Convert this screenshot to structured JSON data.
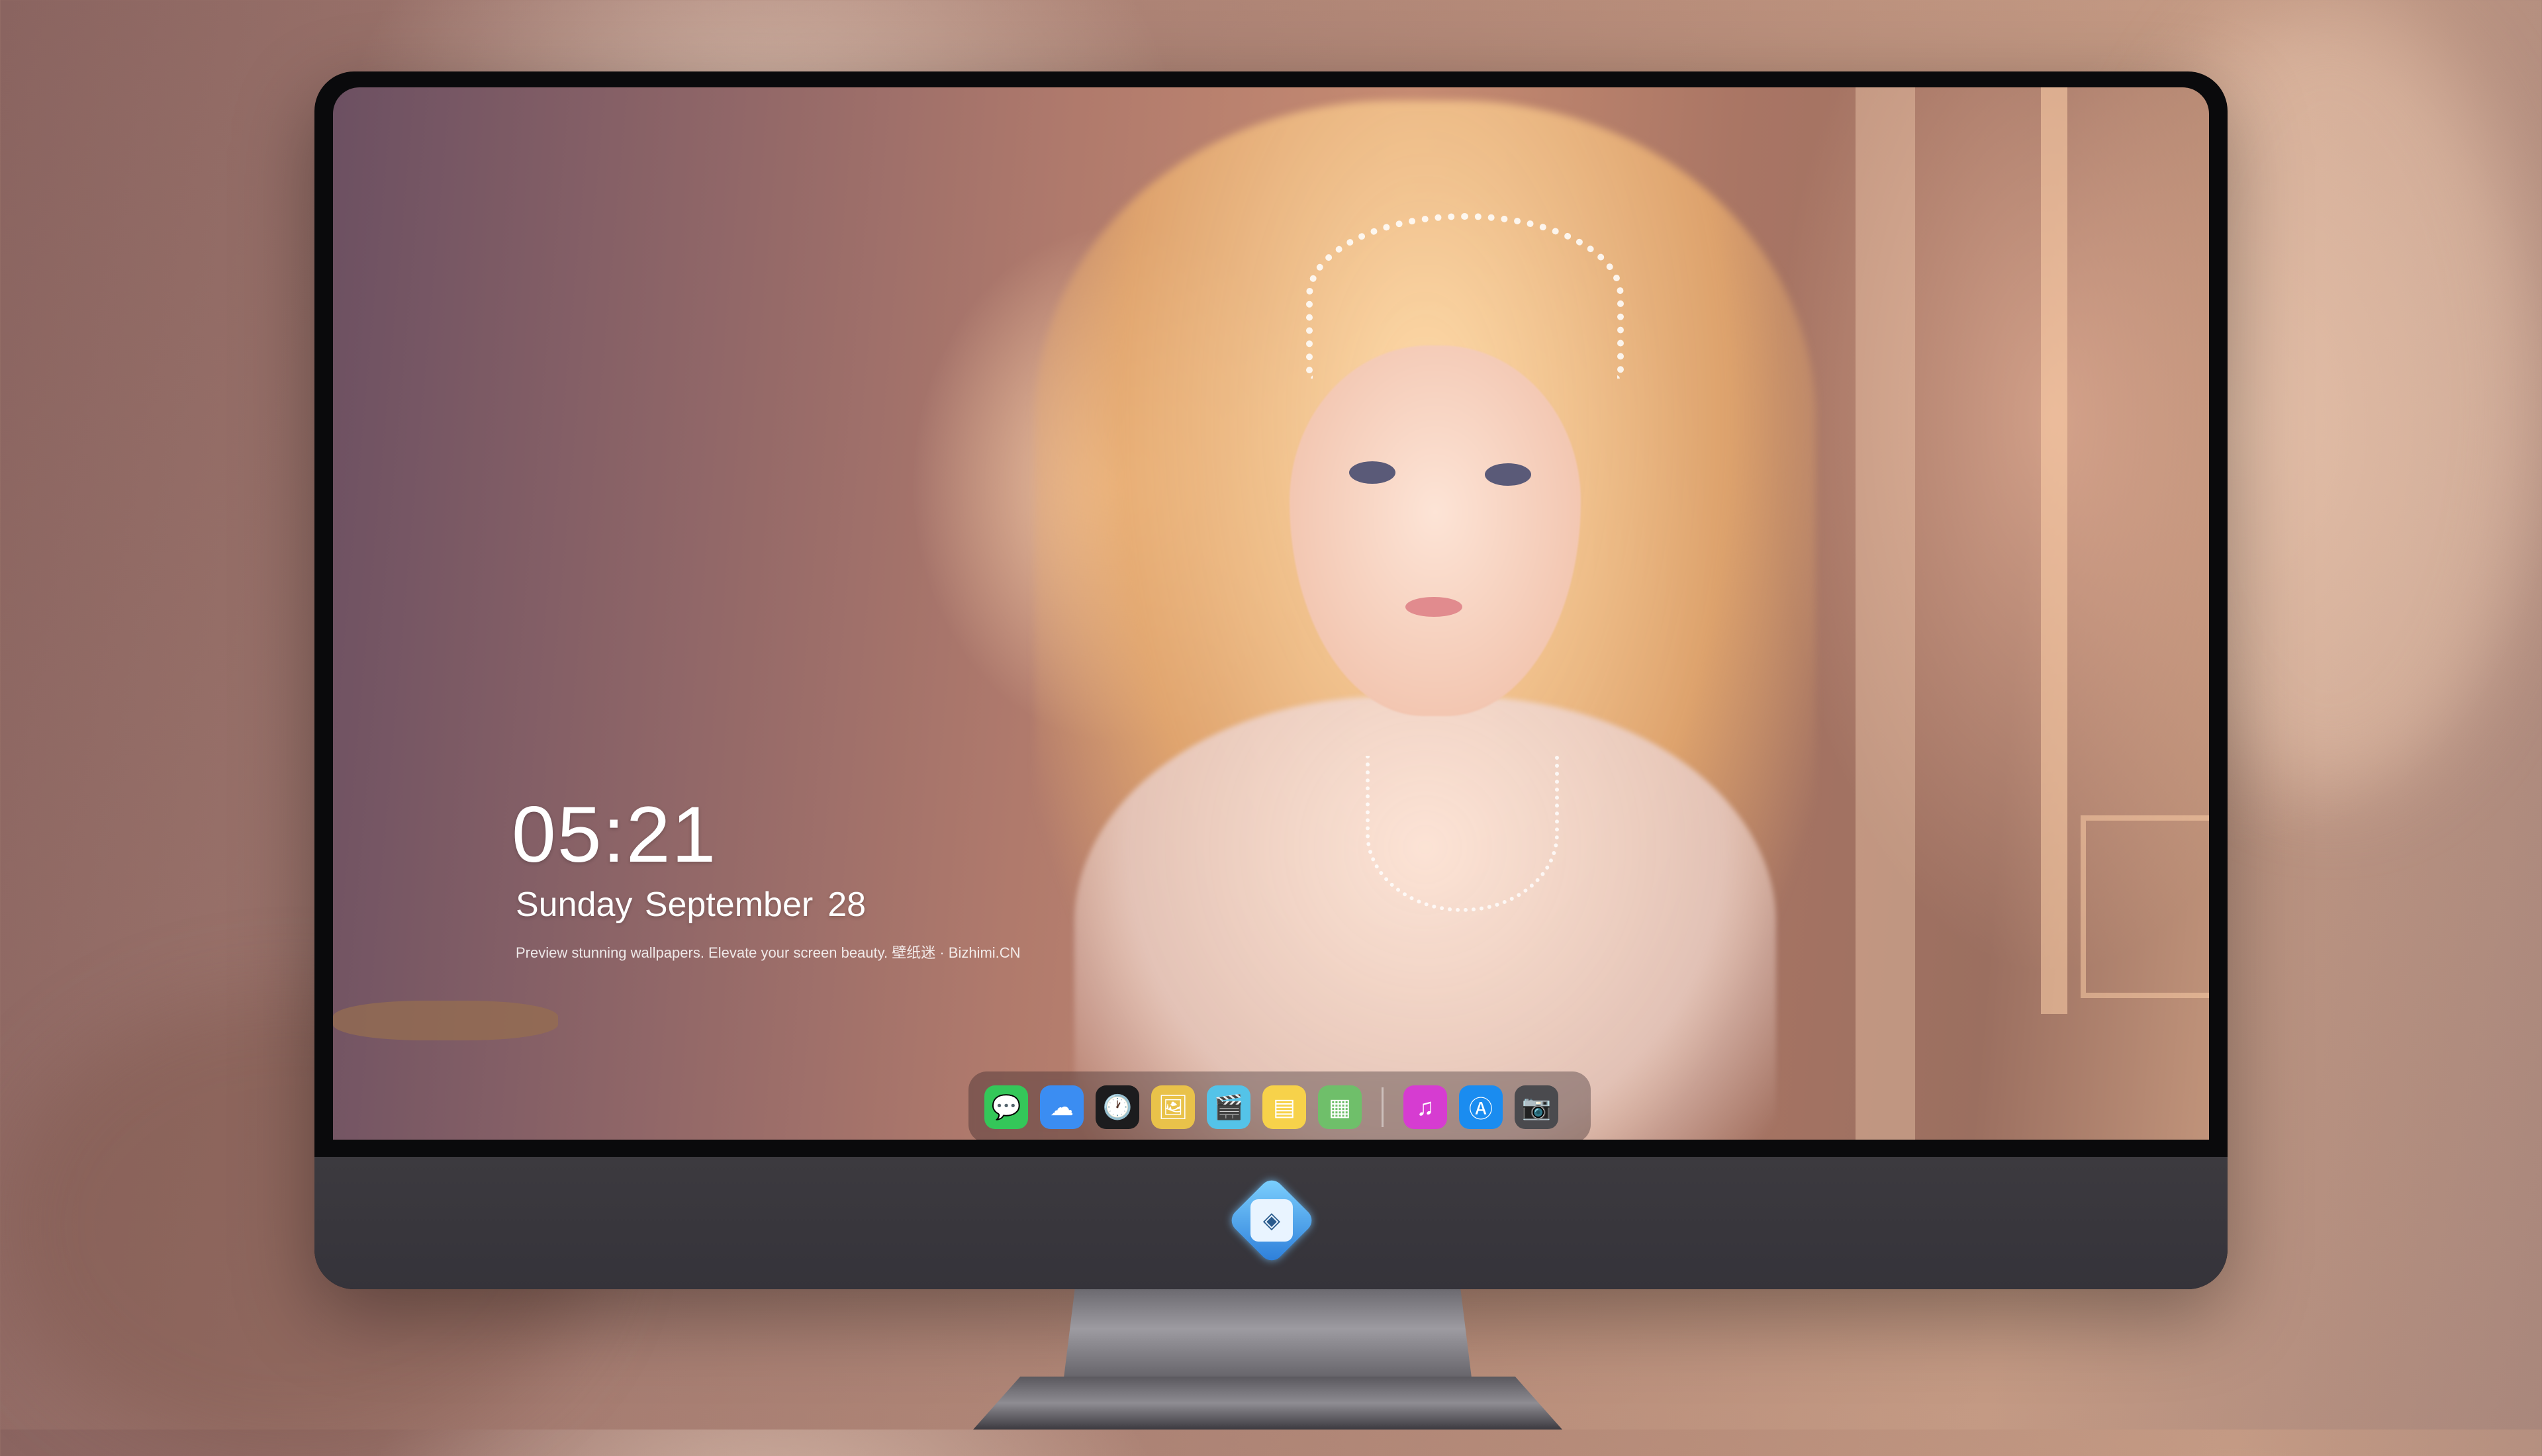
{
  "lockscreen": {
    "time": "05:21",
    "weekday": "Sunday",
    "month": "September",
    "day": "28",
    "tagline": "Preview stunning wallpapers. Elevate your screen beauty. 壁纸迷 · Bizhimi.CN"
  },
  "dock": {
    "apps": [
      {
        "name": "messages-icon",
        "glyph": "💬",
        "color": "#34c759"
      },
      {
        "name": "weather-icon",
        "glyph": "☁",
        "color": "#3b8df2"
      },
      {
        "name": "clock-icon",
        "glyph": "🕐",
        "color": "#1c1c1e"
      },
      {
        "name": "preview-icon",
        "glyph": "🖼",
        "color": "#e9c24a"
      },
      {
        "name": "clips-icon",
        "glyph": "🎬",
        "color": "#54c3e8"
      },
      {
        "name": "notes-icon",
        "glyph": "▤",
        "color": "#f7d24a"
      },
      {
        "name": "photo-booth-icon",
        "glyph": "▦",
        "color": "#6fbf6a"
      },
      {
        "name": "itunes-icon",
        "glyph": "♫",
        "color": "#d63cd1"
      },
      {
        "name": "app-store-icon",
        "glyph": "Ⓐ",
        "color": "#1a8cf0"
      },
      {
        "name": "camera-icon",
        "glyph": "📷",
        "color": "#4a4a4e"
      }
    ]
  },
  "monitor": {
    "logo_glyph": "◈"
  }
}
